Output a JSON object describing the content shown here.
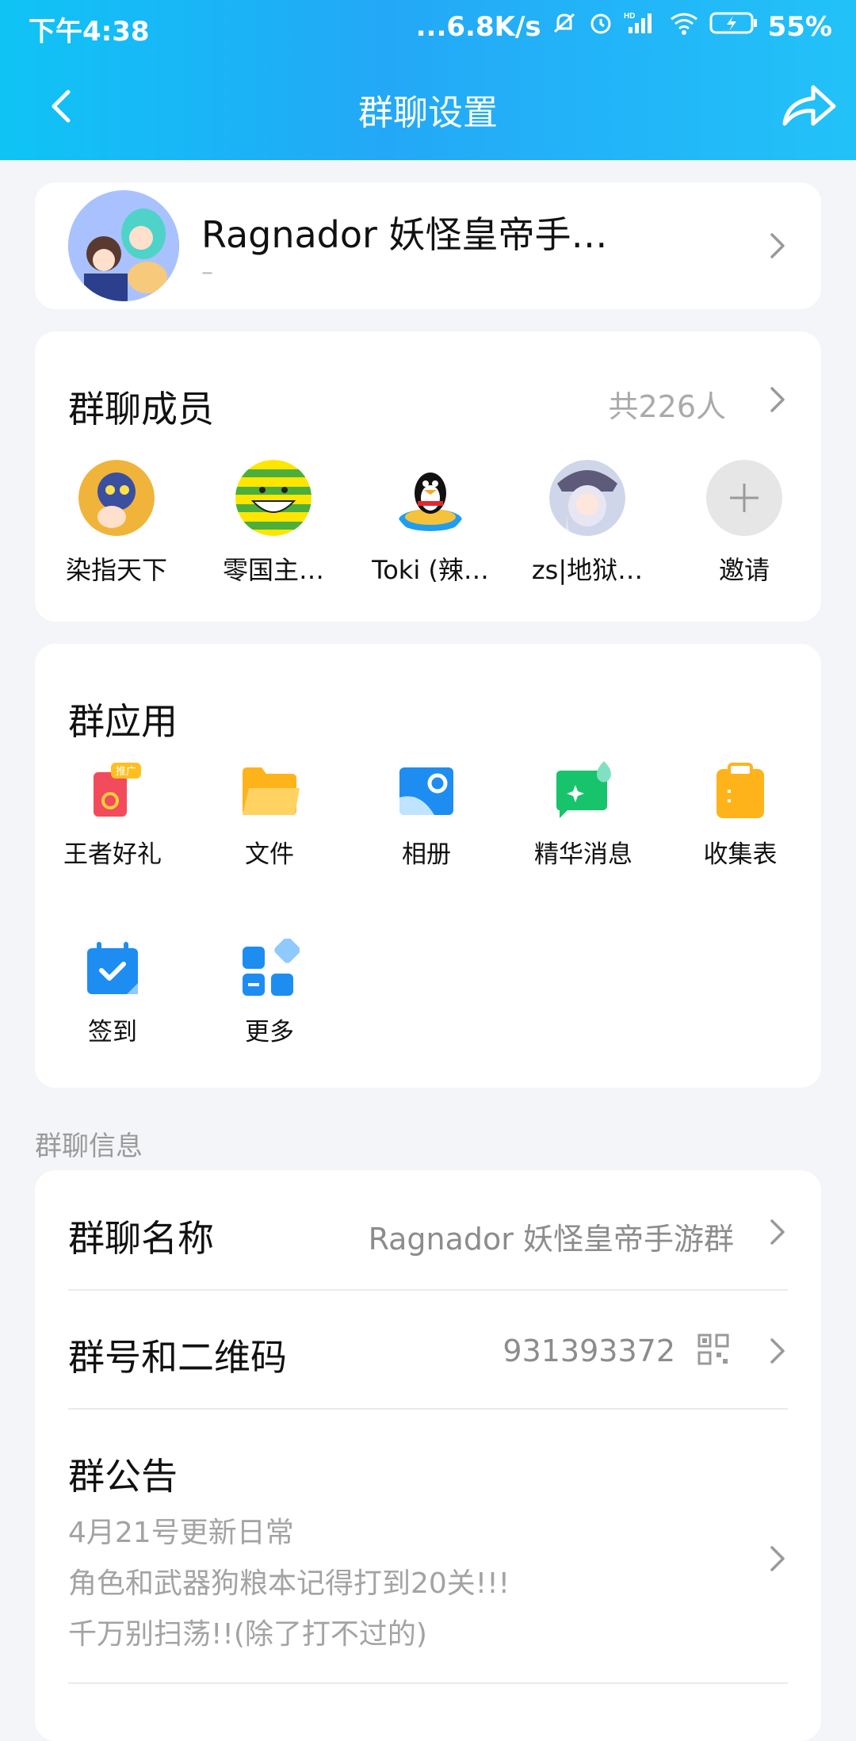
{
  "status": {
    "time": "下午4:38",
    "network_speed": "...6.8K/s",
    "battery": "55%",
    "hd_label": "HD"
  },
  "header": {
    "title": "群聊设置",
    "back_icon": "chevron-left-icon",
    "share_icon": "share-arrow-icon"
  },
  "group": {
    "name": "Ragnador 妖怪皇帝手…",
    "subtitle": "–"
  },
  "members": {
    "title": "群聊成员",
    "count": "共226人",
    "items": [
      {
        "name": "染指天下"
      },
      {
        "name": "零国主…"
      },
      {
        "name": "Toki (辣…"
      },
      {
        "name": "zs|地狱…"
      },
      {
        "name": "邀请"
      }
    ]
  },
  "apps": {
    "title": "群应用",
    "items": [
      {
        "label": "王者好礼",
        "icon": "gift-card-icon",
        "badge": "推广"
      },
      {
        "label": "文件",
        "icon": "folder-icon"
      },
      {
        "label": "相册",
        "icon": "photo-album-icon"
      },
      {
        "label": "精华消息",
        "icon": "highlight-message-icon"
      },
      {
        "label": "收集表",
        "icon": "clipboard-icon"
      },
      {
        "label": "签到",
        "icon": "calendar-check-icon"
      },
      {
        "label": "更多",
        "icon": "more-grid-icon"
      }
    ]
  },
  "info": {
    "section_label": "群聊信息",
    "name_row": {
      "title": "群聊名称",
      "value": "Ragnador 妖怪皇帝手游群"
    },
    "id_row": {
      "title": "群号和二维码",
      "value": "931393372"
    },
    "notice": {
      "title": "群公告",
      "lines": [
        "4月21号更新日常",
        "角色和武器狗粮本记得打到20关!!!",
        "千万别扫荡!!(除了打不过的)"
      ]
    }
  },
  "colors": {
    "header_gradient_start": "#0fc4f5",
    "header_gradient_end": "#22c2f8",
    "page_bg": "#f3f5f8",
    "muted_text": "#a3a3a3"
  }
}
